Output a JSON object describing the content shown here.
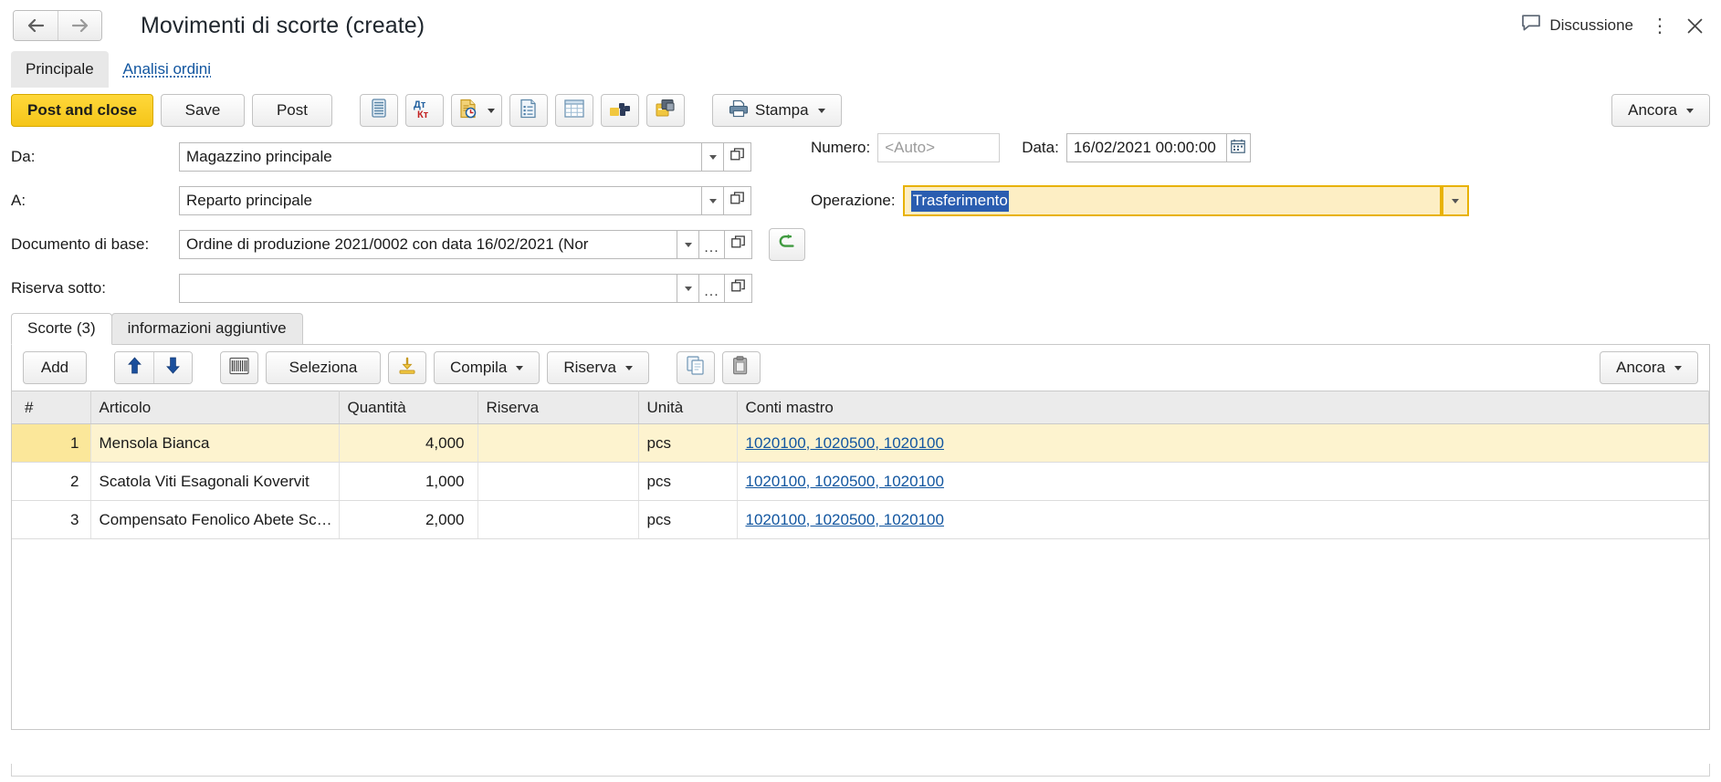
{
  "window": {
    "title": "Movimenti di scorte (create)",
    "nav_back": "back-arrow",
    "nav_forward": "forward-arrow",
    "discussione_label": "Discussione",
    "kebab_label": "⋮",
    "close_label": "close"
  },
  "outer_tabs": [
    {
      "label": "Principale",
      "active": true
    },
    {
      "label": "Analisi ordini",
      "active": false
    }
  ],
  "toolbar": {
    "post_and_close": "Post and close",
    "save": "Save",
    "post": "Post",
    "stampa": "Stampa",
    "ancora": "Ancora",
    "icon_buttons": [
      "ledger-icon",
      "debit-credit-icon",
      "document-history-icon",
      "report-list-icon",
      "spreadsheet-icon",
      "structure-icon",
      "archive-lock-icon"
    ],
    "accent_color": "#f5c518"
  },
  "form": {
    "da_label": "Da:",
    "da_value": "Magazzino principale",
    "a_label": "A:",
    "a_value": "Reparto principale",
    "doc_label": "Documento di base:",
    "doc_value": "Ordine di produzione 2021/0002 con data 16/02/2021 (Nor",
    "riserva_label": "Riserva sotto:",
    "riserva_value": "",
    "numero_label": "Numero:",
    "numero_placeholder": "<Auto>",
    "numero_value": "",
    "data_label": "Data:",
    "data_value": "16/02/2021 00:00:00",
    "operazione_label": "Operazione:",
    "operazione_value": "Trasferimento",
    "ellipsis": "...",
    "focus_border_color": "#e8b200",
    "focus_fill_color": "#fdeec4",
    "selection_color": "#2a5db0"
  },
  "inner_tabs": [
    {
      "label": "Scorte (3)",
      "active": true
    },
    {
      "label": "informazioni aggiuntive",
      "active": false
    }
  ],
  "grid_toolbar": {
    "add": "Add",
    "move_up": "arrow-up-icon",
    "move_down": "arrow-down-icon",
    "barcode": "barcode-icon",
    "seleziona": "Seleziona",
    "fill_download": "download-icon",
    "compila": "Compila",
    "riserva": "Riserva",
    "copy": "copy-icon",
    "paste": "paste-icon",
    "ancora": "Ancora"
  },
  "grid": {
    "columns": [
      "#",
      "Articolo",
      "Quantità",
      "Riserva",
      "Unità",
      "Conti mastro"
    ],
    "rows": [
      {
        "num": "1",
        "articolo": "Mensola Bianca",
        "quantita": "4,000",
        "riserva": "",
        "unita": "pcs",
        "conti": "1020100, 1020500, 1020100",
        "selected": true
      },
      {
        "num": "2",
        "articolo": "Scatola Viti Esagonali Kovervit",
        "quantita": "1,000",
        "riserva": "",
        "unita": "pcs",
        "conti": "1020100, 1020500, 1020100",
        "selected": false
      },
      {
        "num": "3",
        "articolo": "Compensato Fenolico Abete Sc…",
        "quantita": "2,000",
        "riserva": "",
        "unita": "pcs",
        "conti": "1020100, 1020500, 1020100",
        "selected": false
      }
    ],
    "selected_row_color": "#fdf3cf",
    "link_color": "#1256a0"
  }
}
